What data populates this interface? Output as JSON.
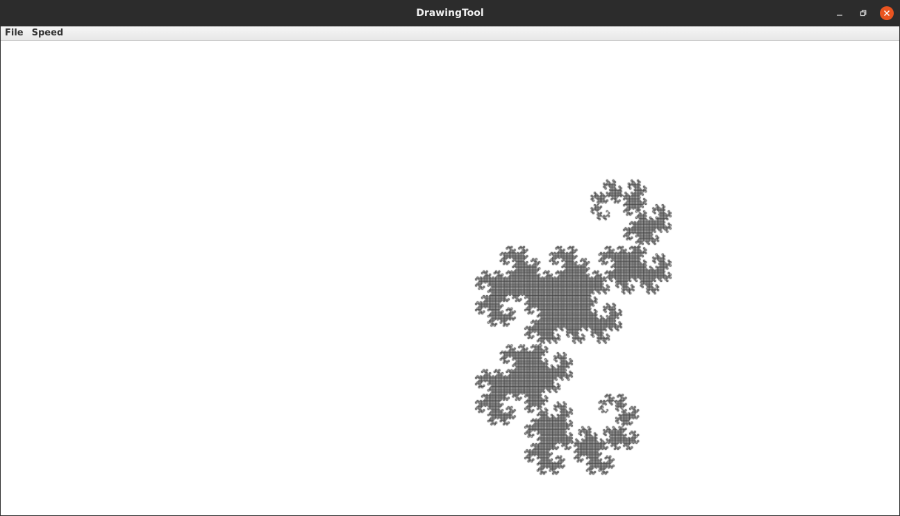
{
  "window": {
    "title": "DrawingTool"
  },
  "menubar": {
    "items": [
      {
        "label": "File"
      },
      {
        "label": "Speed"
      }
    ]
  },
  "controls": {
    "minimize_icon": "minimize-icon",
    "maximize_icon": "restore-icon",
    "close_icon": "close-icon",
    "close_color": "#e95420"
  },
  "canvas": {
    "background": "#ffffff",
    "drawing": "dragon-curve-fractal",
    "stroke_color": "#333333"
  }
}
